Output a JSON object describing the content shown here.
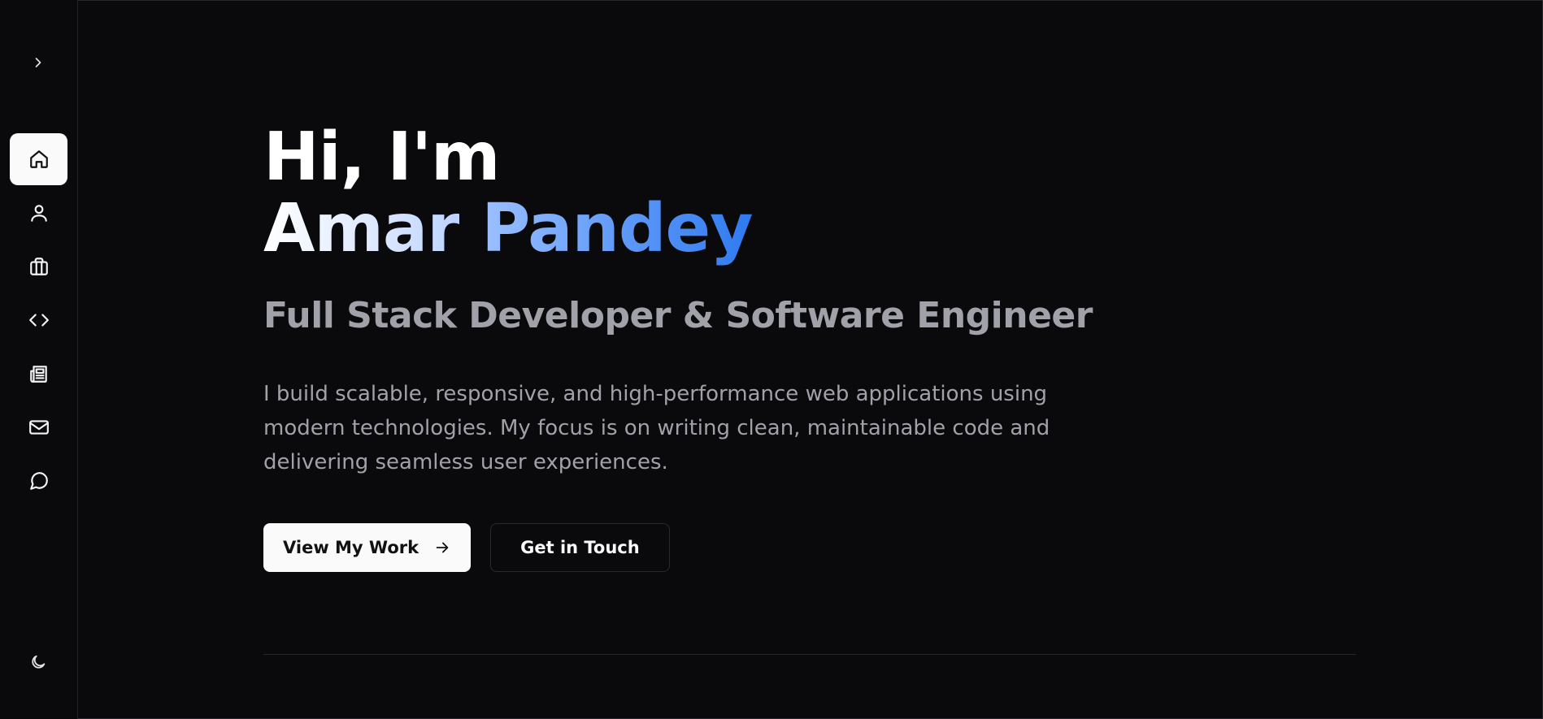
{
  "sidebar": {
    "toggle_icon": "chevron-right-icon",
    "items": [
      {
        "icon": "home-icon",
        "active": true
      },
      {
        "icon": "user-icon",
        "active": false
      },
      {
        "icon": "briefcase-icon",
        "active": false
      },
      {
        "icon": "code-icon",
        "active": false
      },
      {
        "icon": "newspaper-icon",
        "active": false
      },
      {
        "icon": "mail-icon",
        "active": false
      },
      {
        "icon": "message-circle-icon",
        "active": false
      }
    ],
    "theme_icon": "moon-icon"
  },
  "hero": {
    "greeting": "Hi, I'm",
    "first_name": "Amar",
    "last_name": "Pandey",
    "role": "Full Stack Developer & Software Engineer",
    "bio": "I build scalable, responsive, and high-performance web applications using modern technologies. My focus is on writing clean, maintainable code and delivering seamless user experiences.",
    "primary_button": "View My Work",
    "secondary_button": "Get in Touch"
  },
  "colors": {
    "background": "#0a0a0c",
    "text_muted": "#a1a1aa",
    "accent": "#3b82f6",
    "button_light": "#fafafa"
  }
}
